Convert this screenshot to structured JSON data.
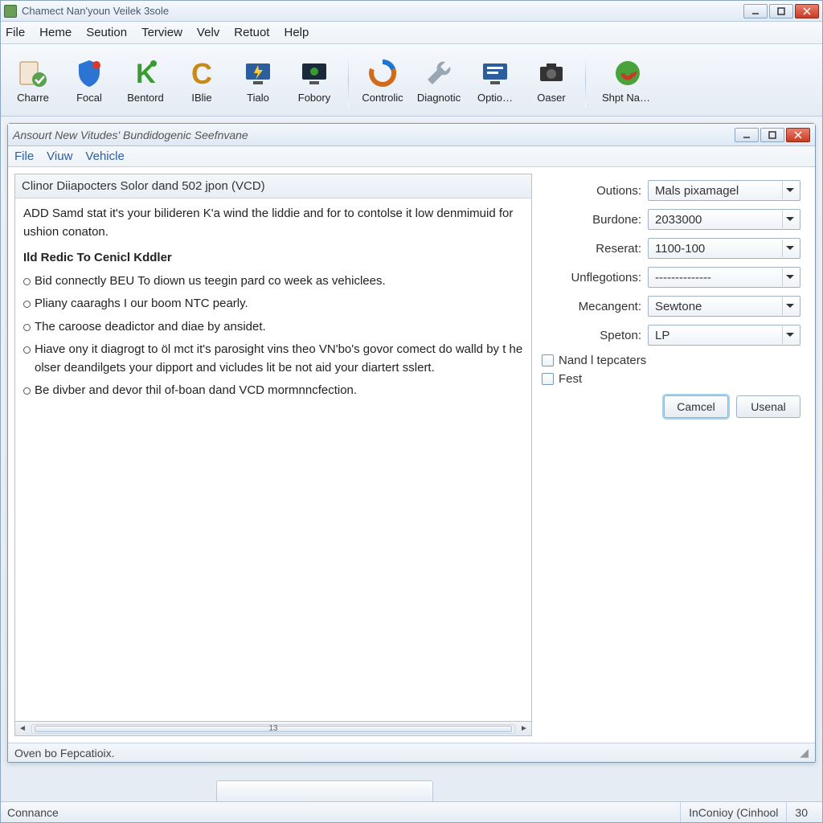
{
  "outer": {
    "title": "Chamect Nan'youn Veilek 3sole",
    "menu": [
      "File",
      "Heme",
      "Seution",
      "Terview",
      "Velv",
      "Retuot",
      "Help"
    ],
    "toolbar": [
      {
        "label": "Charre"
      },
      {
        "label": "Focal"
      },
      {
        "label": "Bentord"
      },
      {
        "label": "IBlie"
      },
      {
        "label": "Tialo"
      },
      {
        "label": "Fobory"
      },
      {
        "label": "Controlic"
      },
      {
        "label": "Diagnotic"
      },
      {
        "label": "Optio…"
      },
      {
        "label": "Oaser"
      },
      {
        "label": "Shpt Name"
      }
    ],
    "status_left": "Connance",
    "status_right_a": "InConioy (Cinhool",
    "status_right_b": "30"
  },
  "child": {
    "title": "Ansourt New Vitudes' Bundidogenic Seefnvane",
    "menu": [
      "File",
      "Viuw",
      "Vehicle"
    ],
    "doc_title": "Clinor Diiapocters Solor dand 502 jpon (VCD)",
    "intro": "ADD Samd stat it's your bilideren K'a wind the liddie and for to contolse it low denmimuid for ushion conaton.",
    "heading": "Ild Redic To Cenicl Kddler",
    "bullets": [
      "Bid connectly BEU To diown us teegin pard co week as vehiclees.",
      "Pliany caaraghs I our boom NTC pearly.",
      "The caroose deadictor and diae by ansidet.",
      "Hiave ony it diagrogt to öl mct it's parosight vins theo VN'bo's govor comect do walld by t he olser deandilgets your dipport and vicludes lit be not aid your diartert sslert.",
      "Be divber and devor thil of-boan dand VCD mormnncfection."
    ],
    "scroll_label": "13",
    "status": "Oven bo Fepcatioix."
  },
  "form": {
    "fields": [
      {
        "label": "Outions:",
        "value": "Mals pixamagel"
      },
      {
        "label": "Burdone:",
        "value": "2033000"
      },
      {
        "label": "Reserat:",
        "value": "1100-100"
      },
      {
        "label": "Unflegotions:",
        "value": "--------------"
      },
      {
        "label": "Mecangent:",
        "value": "Sewtone"
      },
      {
        "label": "Speton:",
        "value": "LP"
      }
    ],
    "checkboxes": [
      {
        "label": "Nand l tepcaters"
      },
      {
        "label": "Fest"
      }
    ],
    "buttons": {
      "cancel": "Camcel",
      "usenal": "Usenal"
    }
  }
}
